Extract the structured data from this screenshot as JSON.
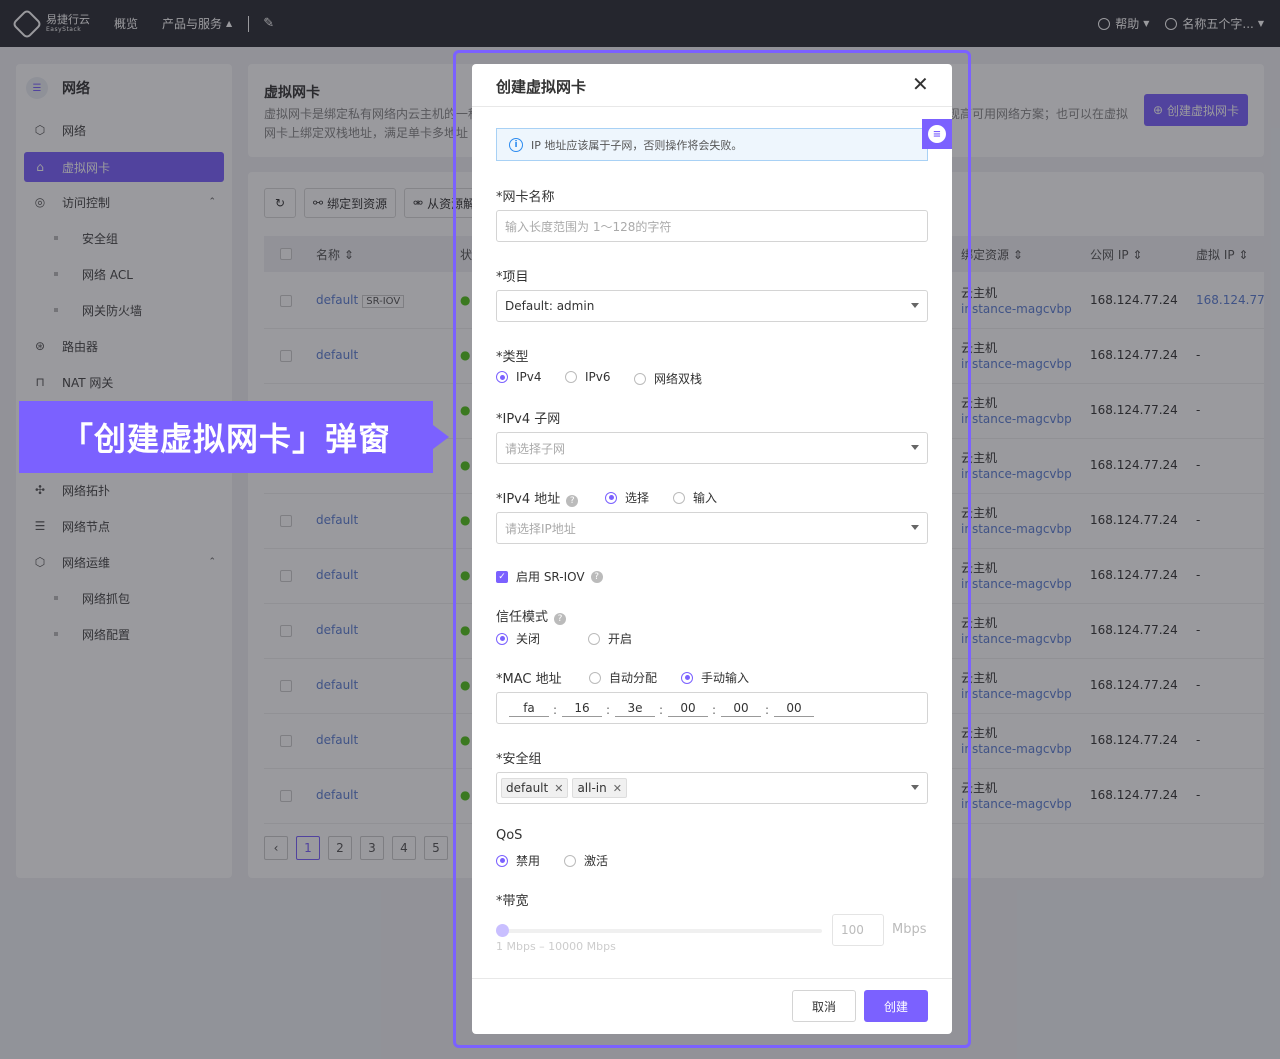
{
  "topbar": {
    "logo_cn": "易捷行云",
    "logo_en": "EasyStack",
    "nav_overview": "概览",
    "nav_products": "产品与服务",
    "help": "帮助",
    "user": "名称五个字..."
  },
  "sidebar": {
    "title": "网络",
    "items": [
      {
        "label": "网络",
        "icon": "network-icon"
      },
      {
        "label": "虚拟网卡",
        "icon": "nic-icon"
      },
      {
        "label": "访问控制",
        "icon": "access-icon"
      },
      {
        "label": "安全组"
      },
      {
        "label": "网络 ACL"
      },
      {
        "label": "网关防火墙"
      },
      {
        "label": "路由器",
        "icon": "router-icon"
      },
      {
        "label": "NAT 网关",
        "icon": "nat-icon"
      },
      {
        "label": "网络拓扑",
        "icon": "topology-icon"
      },
      {
        "label": "网络节点",
        "icon": "node-icon"
      },
      {
        "label": "网络运维",
        "icon": "ops-icon"
      },
      {
        "label": "网络抓包"
      },
      {
        "label": "网络配置"
      }
    ]
  },
  "page": {
    "title": "虚拟网卡",
    "desc1": "虚拟网卡是绑定私有网络内云主机的一种",
    "desc2": "网卡上绑定双栈地址，满足单卡多地址",
    "desc_right": "现高可用网络方案；也可以在虚拟",
    "create_button": "创建虚拟网卡",
    "toolbar": {
      "bind": "绑定到资源",
      "unbind": "从资源解"
    }
  },
  "table": {
    "headers": {
      "name": "名称",
      "status": "状",
      "bound": "绑定资源",
      "public_ip": "公网 IP",
      "virtual_ip": "虚拟 IP"
    },
    "rows": [
      {
        "name": "default",
        "badge": "SR-IOV",
        "res1": "云主机",
        "res2": "instance-magcvbp",
        "pip": "168.124.77.24",
        "vip": "168.124.77"
      },
      {
        "name": "default",
        "res1": "云主机",
        "res2": "instance-magcvbp",
        "pip": "168.124.77.24",
        "vip": "-"
      },
      {
        "name": "",
        "res1": "云主机",
        "res2": "instance-magcvbp",
        "pip": "168.124.77.24",
        "vip": "-"
      },
      {
        "name": "",
        "res1": "云主机",
        "res2": "instance-magcvbp",
        "pip": "168.124.77.24",
        "vip": "-"
      },
      {
        "name": "default",
        "res1": "云主机",
        "res2": "instance-magcvbp",
        "pip": "168.124.77.24",
        "vip": "-"
      },
      {
        "name": "default",
        "res1": "云主机",
        "res2": "instance-magcvbp",
        "pip": "168.124.77.24",
        "vip": "-"
      },
      {
        "name": "default",
        "res1": "云主机",
        "res2": "instance-magcvbp",
        "pip": "168.124.77.24",
        "vip": "-"
      },
      {
        "name": "default",
        "res1": "云主机",
        "res2": "instance-magcvbp",
        "pip": "168.124.77.24",
        "vip": "-"
      },
      {
        "name": "default",
        "res1": "云主机",
        "res2": "instance-magcvbp",
        "pip": "168.124.77.24",
        "vip": "-"
      },
      {
        "name": "default",
        "res1": "云主机",
        "res2": "instance-magcvbp",
        "pip": "168.124.77.24",
        "vip": "-"
      }
    ],
    "pages": [
      "1",
      "2",
      "3",
      "4",
      "5"
    ],
    "current_page": "1"
  },
  "callout": "「创建虚拟网卡」弹窗",
  "modal": {
    "title": "创建虚拟网卡",
    "alert": "IP 地址应该属于子网，否则操作将会失败。",
    "name_label": "*网卡名称",
    "name_placeholder": "输入长度范围为 1～128的字符",
    "project_label": "*项目",
    "project_value": "Default: admin",
    "type_label": "*类型",
    "type_options": [
      "IPv4",
      "IPv6",
      "网络双栈"
    ],
    "subnet_label": "*IPv4 子网",
    "subnet_placeholder": "请选择子网",
    "addr_label": "*IPv4 地址",
    "addr_options": [
      "选择",
      "输入"
    ],
    "addr_placeholder": "请选择IP地址",
    "sriov_label": "启用 SR-IOV",
    "trust_label": "信任模式",
    "trust_options": [
      "关闭",
      "开启"
    ],
    "mac_label": "*MAC 地址",
    "mac_options": [
      "自动分配",
      "手动输入"
    ],
    "mac_values": [
      "fa",
      "16",
      "3e",
      "00",
      "00",
      "00"
    ],
    "sg_label": "*安全组",
    "sg_tags": [
      "default",
      "all-in"
    ],
    "qos_label": "QoS",
    "qos_options": [
      "禁用",
      "激活"
    ],
    "bw_label": "*带宽",
    "bw_value": "100",
    "bw_unit": "Mbps",
    "bw_hint": "1 Mbps – 10000 Mbps",
    "bw_level": 0,
    "cancel": "取消",
    "ok": "创建"
  },
  "colors": {
    "accent": "#7b61ff",
    "link": "#5b7ed4",
    "topbar": "#2b2d33"
  }
}
